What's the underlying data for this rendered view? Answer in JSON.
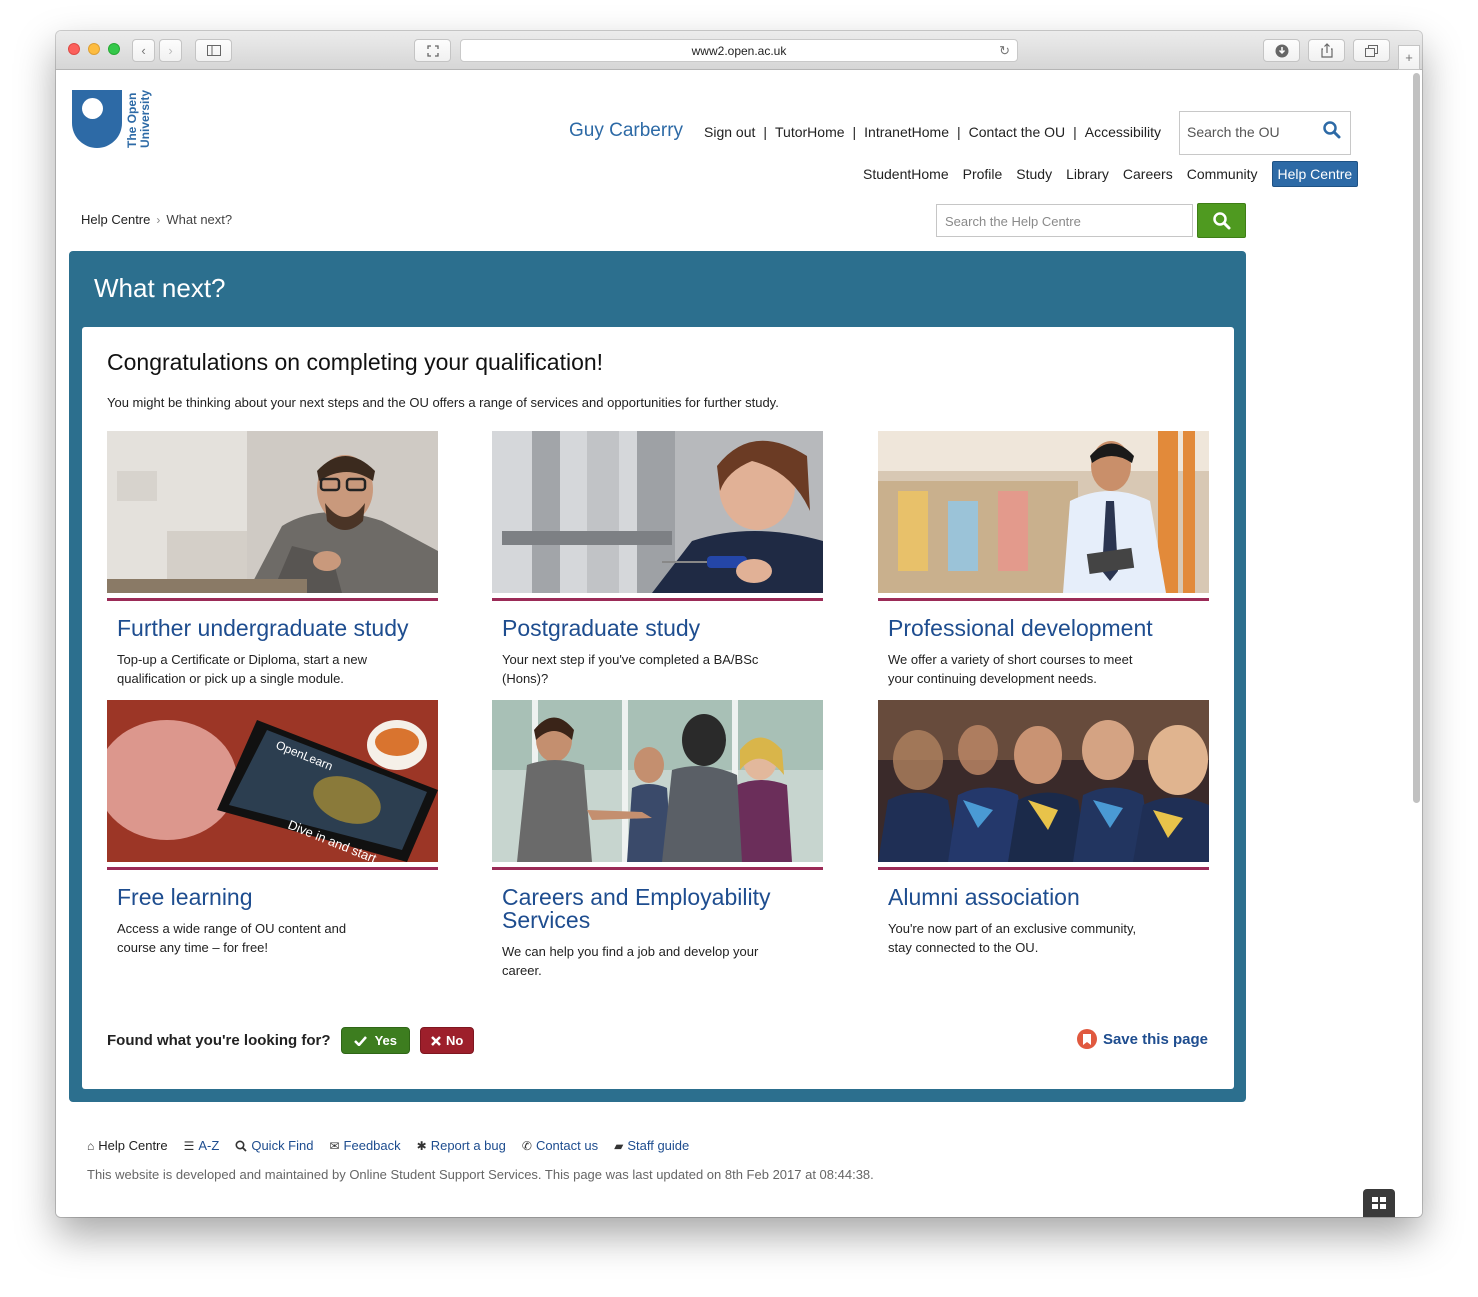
{
  "browser": {
    "url": "www2.open.ac.uk"
  },
  "logo": {
    "text_line1": "The Open",
    "text_line2": "University"
  },
  "header": {
    "user_name": "Guy Carberry",
    "top_links": [
      "Sign out",
      "TutorHome",
      "IntranetHome",
      "Contact the OU",
      "Accessibility"
    ],
    "search_placeholder": "Search the OU",
    "nav": [
      "StudentHome",
      "Profile",
      "Study",
      "Library",
      "Careers",
      "Community"
    ],
    "nav_active": "Help Centre"
  },
  "breadcrumb": {
    "home": "Help Centre",
    "current": "What next?"
  },
  "help_search": {
    "placeholder": "Search the Help Centre"
  },
  "panel": {
    "title": "What next?",
    "headline": "Congratulations on completing your qualification!",
    "intro": "You might be thinking about your next steps and the OU offers a range of services and opportunities for further study."
  },
  "tiles": [
    {
      "title": "Further undergraduate study",
      "desc": "Top-up a Certificate or Diploma, start a new qualification or pick up a single module."
    },
    {
      "title": "Postgraduate study",
      "desc": "Your next step if you've completed a BA/BSc (Hons)?"
    },
    {
      "title": "Professional development",
      "desc": "We offer a variety of short courses to meet your continuing development needs."
    },
    {
      "title": "Free learning",
      "desc": "Access a wide range of OU content and course any time – for free!",
      "image_text": "OpenLearn",
      "image_caption": "Dive in and start"
    },
    {
      "title": "Careers and Employability Services",
      "desc": "We can help you find a job and develop your career."
    },
    {
      "title": "Alumni association",
      "desc": "You're now part of an exclusive community, stay connected to the OU."
    }
  ],
  "feedback": {
    "question": "Found what you're looking for?",
    "yes": "Yes",
    "no": "No"
  },
  "save": {
    "label": "Save this page"
  },
  "footer": {
    "links": [
      "Help Centre",
      "A-Z",
      "Quick Find",
      "Feedback",
      "Report a bug",
      "Contact us",
      "Staff guide"
    ],
    "note": "This website is developed and maintained by Online Student Support Services. This page was last updated on 8th Feb 2017 at 08:44:38."
  },
  "colors": {
    "brand_blue": "#2d6aa6",
    "panel_teal": "#2c6f8e",
    "accent_maroon": "#9b2b57",
    "title_blue": "#1e4d8f",
    "yes_green": "#3d7d1f",
    "no_red": "#9d1f2b"
  }
}
